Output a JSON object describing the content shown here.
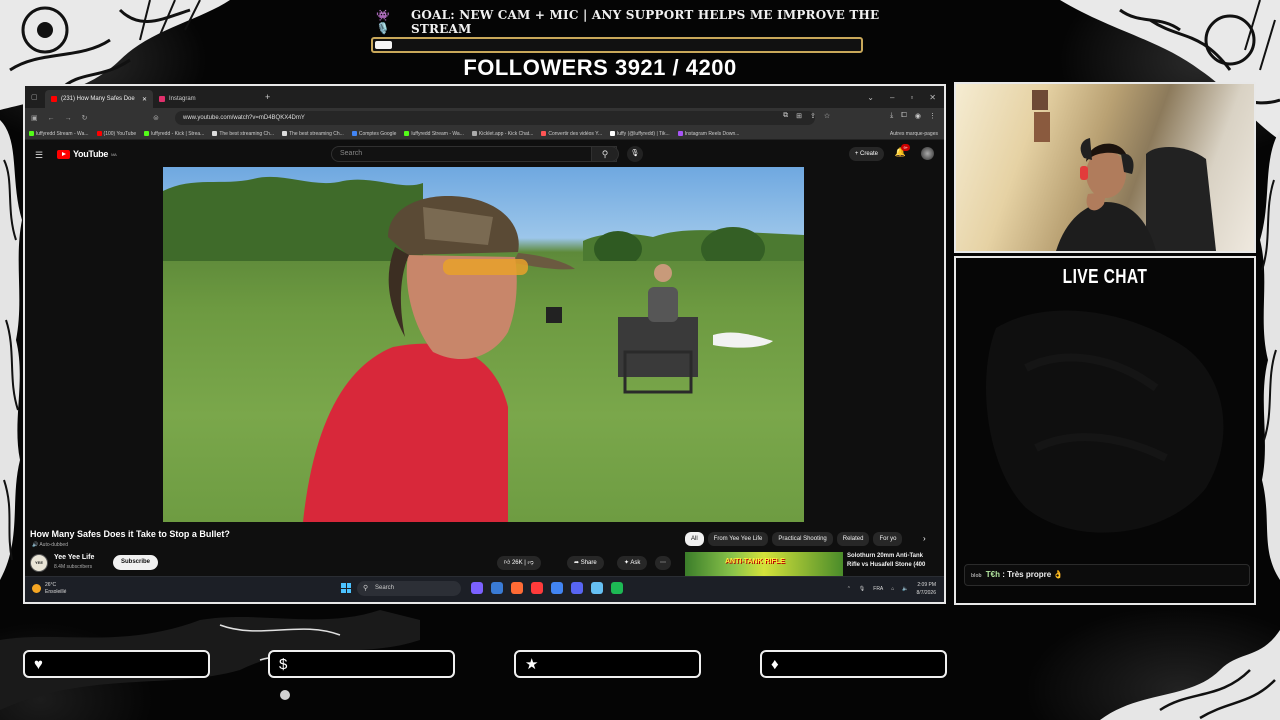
{
  "overlay": {
    "goal_text": "GOAL: NEW CAM + MIC | ANY SUPPORT HELPS ME IMPROVE THE STREAM",
    "goal_icons": "👾 🎙️",
    "goal_progress": 0.035,
    "followers_text": "FOLLOWERS 3921 / 4200",
    "followers_current": 3921,
    "followers_target": 4200,
    "live_chat_title": "LIVE CHAT",
    "chat_messages": [
      {
        "badge": "blob",
        "user": "T€h",
        "text": ": Très propre 👌"
      }
    ],
    "bottom_icons": [
      "heart-icon",
      "dollar-icon",
      "star-icon",
      "drop-icon"
    ],
    "bottom_glyphs": [
      "♥",
      "$",
      "★",
      "♦"
    ]
  },
  "browser": {
    "tabs": [
      {
        "label": "(231) How Many Safes Doe",
        "color": "#ff0000",
        "active": true
      },
      {
        "label": "Instagram",
        "color": "#e1306c",
        "active": false
      }
    ],
    "new_tab": "+",
    "url": "www.youtube.com/watch?v=mD4BQKX4DmY",
    "bookmarks": [
      {
        "label": "luffyredd Stream - Wa...",
        "color": "#53fc18"
      },
      {
        "label": "(100) YouTube",
        "color": "#ff0000"
      },
      {
        "label": "luffyredd - Kick | Strea...",
        "color": "#53fc18"
      },
      {
        "label": "The best streaming Ch...",
        "color": "#dddddd"
      },
      {
        "label": "The best streaming Ch...",
        "color": "#dddddd"
      },
      {
        "label": "Comptes Google",
        "color": "#4285f4"
      },
      {
        "label": "luffyredd Stream - Wa...",
        "color": "#53fc18"
      },
      {
        "label": "Kicklet.app - Kick Chat...",
        "color": "#aaaaaa"
      },
      {
        "label": "Convertir des vidéos Y...",
        "color": "#ff5555"
      },
      {
        "label": "luffy (@luffyredd) | Tik...",
        "color": "#ffffff"
      },
      {
        "label": "Instagram Reels Down...",
        "color": "#a855f7"
      }
    ],
    "bookmarks_more": "Autres marque-pages"
  },
  "youtube": {
    "logo_text": "YouTube",
    "logo_region": "MA",
    "search_placeholder": "Search",
    "create_label": "Create",
    "notif_count": "9+",
    "video_title": "How Many Safes Does it Take to Stop a Bullet?",
    "auto_dubbed": "Auto-dubbed",
    "channel_name": "Yee Yee Life",
    "channel_subs": "8.4M subscribers",
    "channel_avatar_text": "YEE YEE",
    "subscribe_label": "Subscribe",
    "likes": "26K",
    "share_label": "Share",
    "ask_label": "Ask",
    "chips": [
      {
        "label": "All",
        "active": true
      },
      {
        "label": "From Yee Yee Life",
        "active": false
      },
      {
        "label": "Practical Shooting",
        "active": false
      },
      {
        "label": "Related",
        "active": false
      },
      {
        "label": "For yo",
        "active": false
      }
    ],
    "related_thumb_text": "ANTI-TANK RIFLE",
    "related_title": "Solothurn 20mm Anti-Tank Rifle vs Husafell Stone (400"
  },
  "taskbar": {
    "temperature": "26°C",
    "weather": "Ensoleillé",
    "search_label": "Search",
    "app_colors": [
      "#7b61ff",
      "#3a7bd5",
      "#ff6b35",
      "#ff3b3b",
      "#4285f4",
      "#5865f2",
      "#66c0f4",
      "#1db954"
    ],
    "language": "FRA",
    "time": "2:09 PM",
    "date": "8/7/2026"
  }
}
